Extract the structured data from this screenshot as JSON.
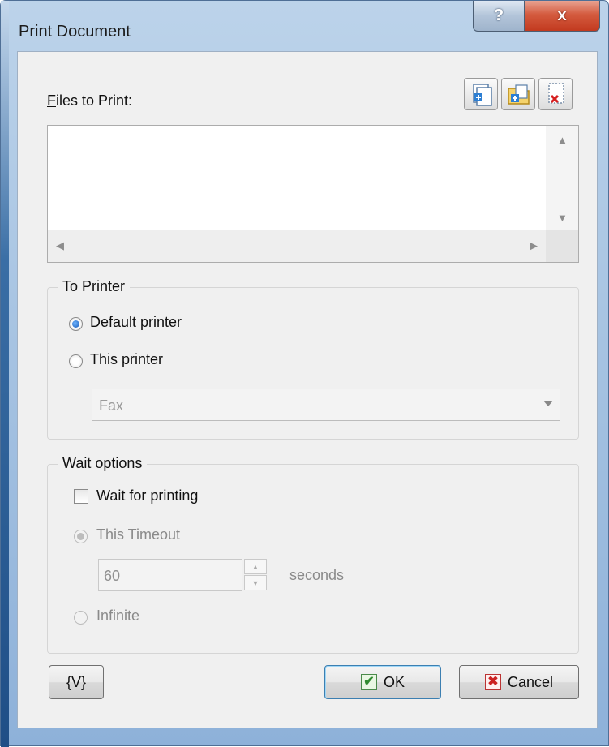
{
  "window": {
    "title": "Print Document",
    "help_label": "?",
    "close_label": "x"
  },
  "files": {
    "label": "Files to Print:",
    "toolbar": {
      "add_file": "add-file-icon",
      "add_folder": "add-folder-icon",
      "remove": "remove-file-icon"
    },
    "items": []
  },
  "to_printer": {
    "title": "To Printer",
    "default_label": "Default printer",
    "this_label": "This printer",
    "selected": "default",
    "printer_value": "Fax"
  },
  "wait": {
    "title": "Wait options",
    "wait_label": "Wait for printing",
    "wait_checked": false,
    "timeout_label": "This Timeout",
    "timeout_value": "60",
    "seconds_label": "seconds",
    "infinite_label": "Infinite"
  },
  "buttons": {
    "variables": "{V}",
    "ok": "OK",
    "cancel": "Cancel"
  },
  "colors": {
    "accent": "#1657b6",
    "ok_check": "#2f8a2f",
    "cancel_x": "#cc2222"
  }
}
